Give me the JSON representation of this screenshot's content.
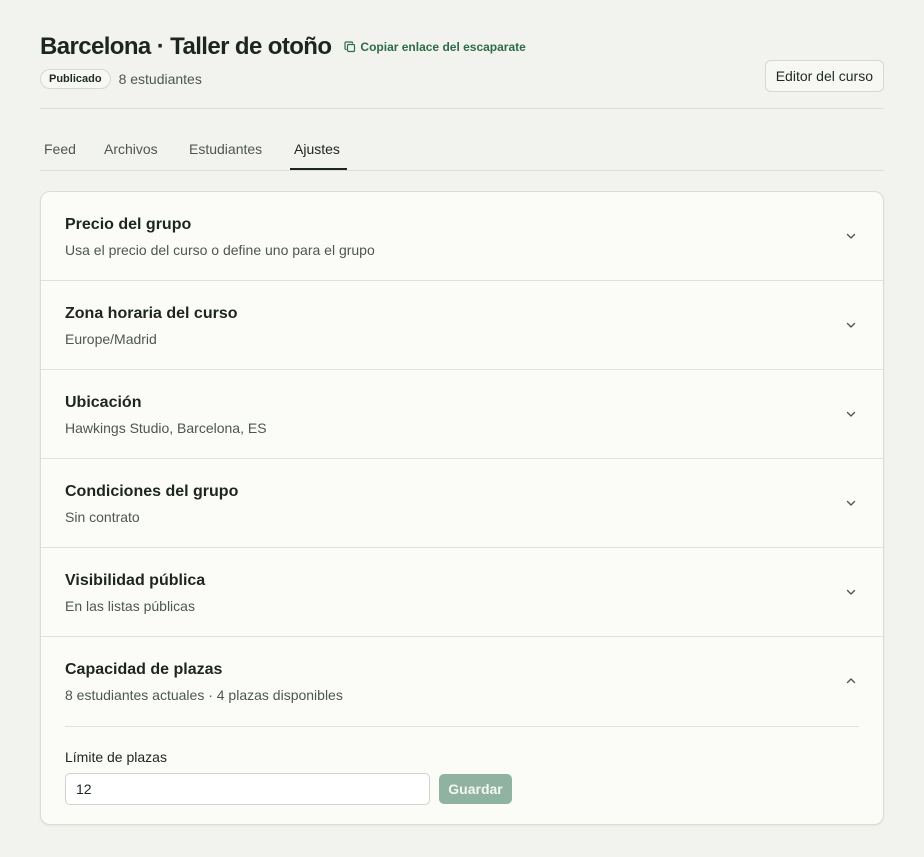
{
  "header": {
    "title": "Barcelona · Taller de otoño",
    "copy_link_label": "Copiar enlace del escaparate",
    "status_badge": "Publicado",
    "students_count": "8 estudiantes",
    "editor_button": "Editor del curso"
  },
  "tabs": [
    {
      "label": "Feed",
      "active": false
    },
    {
      "label": "Archivos",
      "active": false
    },
    {
      "label": "Estudiantes",
      "active": false
    },
    {
      "label": "Ajustes",
      "active": true
    }
  ],
  "settings": [
    {
      "title": "Precio del grupo",
      "subtitle": "Usa el precio del curso o define uno para el grupo",
      "expanded": false
    },
    {
      "title": "Zona horaria del curso",
      "subtitle": "Europe/Madrid",
      "expanded": false
    },
    {
      "title": "Ubicación",
      "subtitle": "Hawkings Studio, Barcelona, ES",
      "expanded": false
    },
    {
      "title": "Condiciones del grupo",
      "subtitle": "Sin contrato",
      "expanded": false
    },
    {
      "title": "Visibilidad pública",
      "subtitle": "En las listas públicas",
      "expanded": false
    },
    {
      "title": "Capacidad de plazas",
      "subtitle": "8 estudiantes actuales · 4 plazas disponibles",
      "expanded": true
    }
  ],
  "capacity": {
    "limit_label": "Límite de plazas",
    "limit_value": "12",
    "save_label": "Guardar"
  },
  "colors": {
    "background": "#f2f3ee",
    "accent": "#2e6b4a",
    "save_button_disabled": "#8fb3a0"
  }
}
